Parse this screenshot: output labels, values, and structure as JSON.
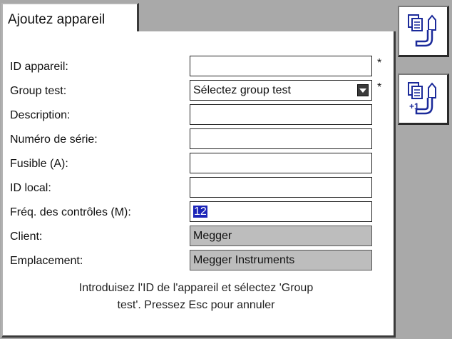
{
  "window": {
    "tab_title": "Ajoutez appareil"
  },
  "form": {
    "rows": [
      {
        "label": "ID appareil:",
        "value": "",
        "required_mark": "*"
      },
      {
        "label": "Group test:",
        "value": "Sélectez group test",
        "required_mark": "*"
      },
      {
        "label": "Description:",
        "value": ""
      },
      {
        "label": "Numéro de série:",
        "value": ""
      },
      {
        "label": "Fusible (A):",
        "value": ""
      },
      {
        "label": "ID local:",
        "value": ""
      },
      {
        "label": "Fréq. des contrôles (M):",
        "value": "12"
      },
      {
        "label": "Client:",
        "value": "Megger"
      },
      {
        "label": "Emplacement:",
        "value": "Megger Instruments"
      }
    ]
  },
  "hint": {
    "line1": "Introduisez l'ID de l'appareil et sélectez 'Group",
    "line2": "test'.  Pressez Esc pour annuler"
  },
  "side_buttons": {
    "save_icon": "document-pen-save-icon",
    "save_next_icon": "document-pen-plus-one-icon",
    "plus_one_text": "+1"
  },
  "colors": {
    "background": "#a9a9a9",
    "panel": "#ffffff",
    "readonly_field": "#bdbdbd",
    "selection": "#1b24b8"
  }
}
